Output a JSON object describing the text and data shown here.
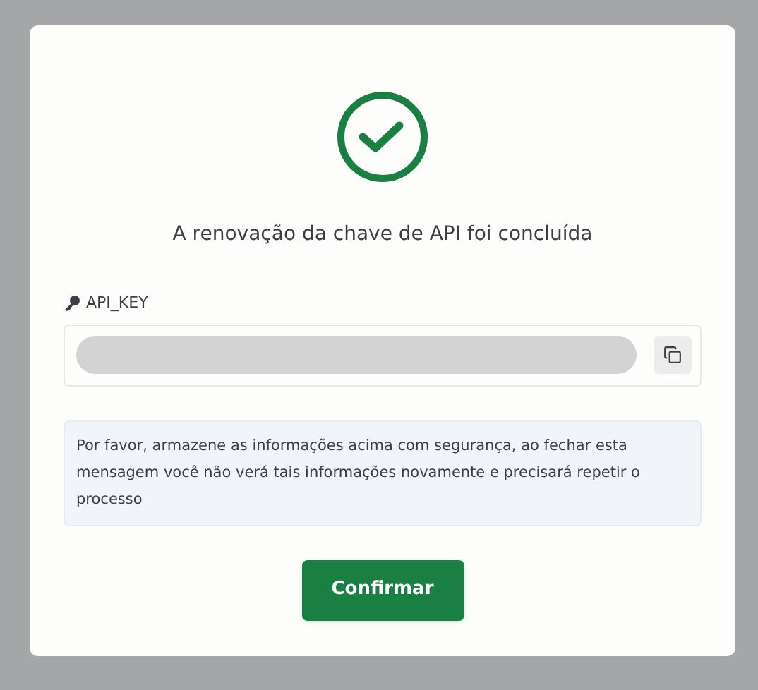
{
  "dialog": {
    "title": "A renovação da chave de API foi concluída",
    "field": {
      "label": "API_KEY",
      "masked": true
    },
    "notice": "Por favor, armazene as informações acima com segurança, ao fechar esta mensagem você não verá tais informações novamente e precisará repetir o processo",
    "button": "Confirmar"
  }
}
